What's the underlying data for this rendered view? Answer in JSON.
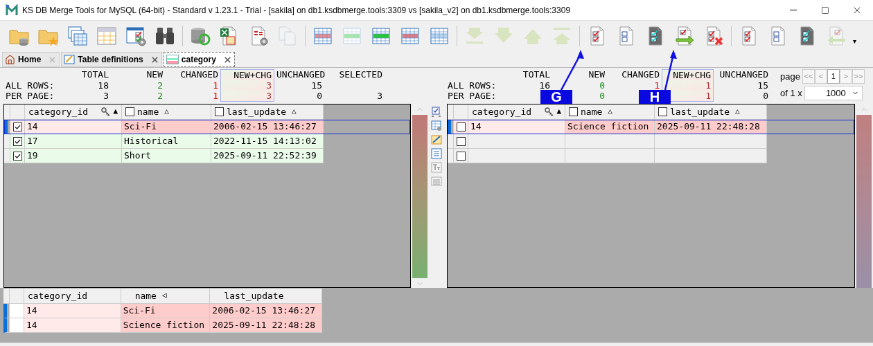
{
  "window": {
    "title": "KS DB Merge Tools for MySQL (64-bit) - Standard v 1.23.1 - Trial - [sakila] on db1.ksdbmerge.tools:3309 vs [sakila_v2] on db1.ksdbmerge.tools:3309"
  },
  "toolbar": [
    {
      "kind": "folder-db",
      "disabled": false
    },
    {
      "kind": "folder-star",
      "disabled": false
    },
    {
      "kind": "tables",
      "disabled": false
    },
    {
      "kind": "select",
      "disabled": false
    },
    {
      "kind": "table-settings",
      "disabled": false
    },
    {
      "kind": "binoculars",
      "disabled": false
    },
    {
      "kind": "separator"
    },
    {
      "kind": "db-refresh",
      "disabled": false
    },
    {
      "kind": "excel-script",
      "disabled": false
    },
    {
      "kind": "script-settings",
      "disabled": false
    },
    {
      "kind": "copy-pages",
      "disabled": true
    },
    {
      "kind": "separator"
    },
    {
      "kind": "grid",
      "color": "#f08a8a",
      "disabled": false
    },
    {
      "kind": "grid",
      "color": "#9ee89e",
      "disabled": true
    },
    {
      "kind": "grid",
      "color": "#22cc22",
      "disabled": false
    },
    {
      "kind": "grid",
      "color": "#ee7777",
      "disabled": false
    },
    {
      "kind": "grid",
      "color": "#b8d4f0",
      "disabled": false
    },
    {
      "kind": "separator"
    },
    {
      "kind": "down-bar",
      "disabled": true
    },
    {
      "kind": "down",
      "disabled": true
    },
    {
      "kind": "up",
      "disabled": true
    },
    {
      "kind": "up-bar",
      "disabled": true
    },
    {
      "kind": "separator"
    },
    {
      "kind": "doc-checks",
      "disabled": false
    },
    {
      "kind": "doc-boxes",
      "disabled": false
    },
    {
      "kind": "doc-dark",
      "disabled": false
    },
    {
      "kind": "doc-arrow-right",
      "disabled": false
    },
    {
      "kind": "doc-x",
      "disabled": false
    },
    {
      "kind": "separator"
    },
    {
      "kind": "doc-checks",
      "disabled": false
    },
    {
      "kind": "doc-boxes",
      "disabled": false
    },
    {
      "kind": "doc-dark",
      "disabled": false
    },
    {
      "kind": "doc-arrow-left",
      "disabled": true
    },
    {
      "kind": "overflow",
      "label": "▾"
    }
  ],
  "tabs": [
    {
      "label": "Home",
      "selected": false,
      "closable": false
    },
    {
      "label": "Table definitions",
      "selected": false,
      "closable": true
    },
    {
      "label": "category",
      "selected": true,
      "closable": true
    }
  ],
  "stats_left": {
    "headers": {
      "total": "TOTAL",
      "new": "NEW",
      "changed": "CHANGED",
      "new_chg": "NEW+CHG",
      "unchanged": "UNCHANGED",
      "selected": "SELECTED"
    },
    "rows": [
      {
        "label": "ALL ROWS:",
        "total": "18",
        "new": "2",
        "changed": "1",
        "new_chg": "3",
        "unchanged": "15"
      },
      {
        "label": "PER PAGE:",
        "total": "3",
        "new": "2",
        "changed": "1",
        "new_chg": "3",
        "unchanged": "0",
        "selected": "3"
      }
    ]
  },
  "stats_right": {
    "headers": {
      "total": "TOTAL",
      "new": "NEW",
      "changed": "CHANGED",
      "new_chg": "NEW+CHG",
      "unchanged": "UNCHANGED"
    },
    "rows": [
      {
        "label": "ALL ROWS:",
        "total": "16",
        "new": "0",
        "changed": "1",
        "new_chg": "1",
        "unchanged": "15"
      },
      {
        "label": "PER PAGE:",
        "new": "0",
        "new_chg": "1",
        "unchanged": "0"
      }
    ]
  },
  "pager": {
    "label": "page",
    "page": "1",
    "of": "of 1 x",
    "page_size": "1000",
    "first": {
      "label": "<<",
      "disabled": true
    },
    "prev": {
      "label": "<",
      "disabled": true
    },
    "next": {
      "label": ">",
      "disabled": true
    },
    "last": {
      "label": ">>",
      "disabled": true
    }
  },
  "left_grid": {
    "columns": [
      {
        "label": "category_id",
        "key": true,
        "sort_mark": "▲"
      },
      {
        "label": "name",
        "key": false,
        "checked": false,
        "sort_mark": "△"
      },
      {
        "label": "last_update",
        "key": false,
        "checked": false,
        "sort_mark": "△"
      }
    ],
    "rows": [
      {
        "kind": "changed",
        "checked": true,
        "current": true,
        "cells": [
          {
            "text": "14",
            "diff": false
          },
          {
            "text": "Sci-Fi",
            "diff": true
          },
          {
            "text": "2006-02-15 13:46:27",
            "diff": true
          }
        ]
      },
      {
        "kind": "new",
        "checked": true,
        "current": false,
        "cells": [
          {
            "text": "17",
            "diff": false
          },
          {
            "text": "Historical",
            "diff": false
          },
          {
            "text": "2022-11-15 14:13:02",
            "diff": false
          }
        ]
      },
      {
        "kind": "new",
        "checked": true,
        "current": false,
        "cells": [
          {
            "text": "19",
            "diff": false
          },
          {
            "text": "Short",
            "diff": false
          },
          {
            "text": "2025-09-11 22:52:39",
            "diff": false
          }
        ]
      }
    ]
  },
  "right_grid": {
    "columns": [
      {
        "label": "category_id",
        "key": true,
        "sort_mark": "▲"
      },
      {
        "label": "name",
        "key": false,
        "checked": false,
        "sort_mark": "△"
      },
      {
        "label": "last_update",
        "key": false,
        "checked": false,
        "sort_mark": "△"
      }
    ],
    "rows": [
      {
        "kind": "changed",
        "checked": false,
        "current": true,
        "cells": [
          {
            "text": "14",
            "diff": false
          },
          {
            "text": "Science fiction",
            "diff": true
          },
          {
            "text": "2025-09-11 22:48:28",
            "diff": true
          }
        ]
      },
      {
        "kind": "empty",
        "checked": false,
        "current": false
      },
      {
        "kind": "empty",
        "checked": false,
        "current": false
      }
    ]
  },
  "bottom_grid": {
    "columns": [
      {
        "label": "category_id"
      },
      {
        "label": "name",
        "sort_mark": "◁"
      },
      {
        "label": "last_update"
      }
    ],
    "rows": [
      {
        "kind": "changed",
        "current": true,
        "cells": [
          {
            "text": "14",
            "diff": false
          },
          {
            "text": "Sci-Fi",
            "diff": true
          },
          {
            "text": "2006-02-15 13:46:27",
            "diff": true
          }
        ]
      },
      {
        "kind": "changed",
        "current": true,
        "cells": [
          {
            "text": "14",
            "diff": false
          },
          {
            "text": "Science fiction",
            "diff": true
          },
          {
            "text": "2025-09-11 22:48:28",
            "diff": true
          }
        ]
      }
    ]
  },
  "callouts": [
    {
      "label": "G"
    },
    {
      "label": "H"
    }
  ]
}
